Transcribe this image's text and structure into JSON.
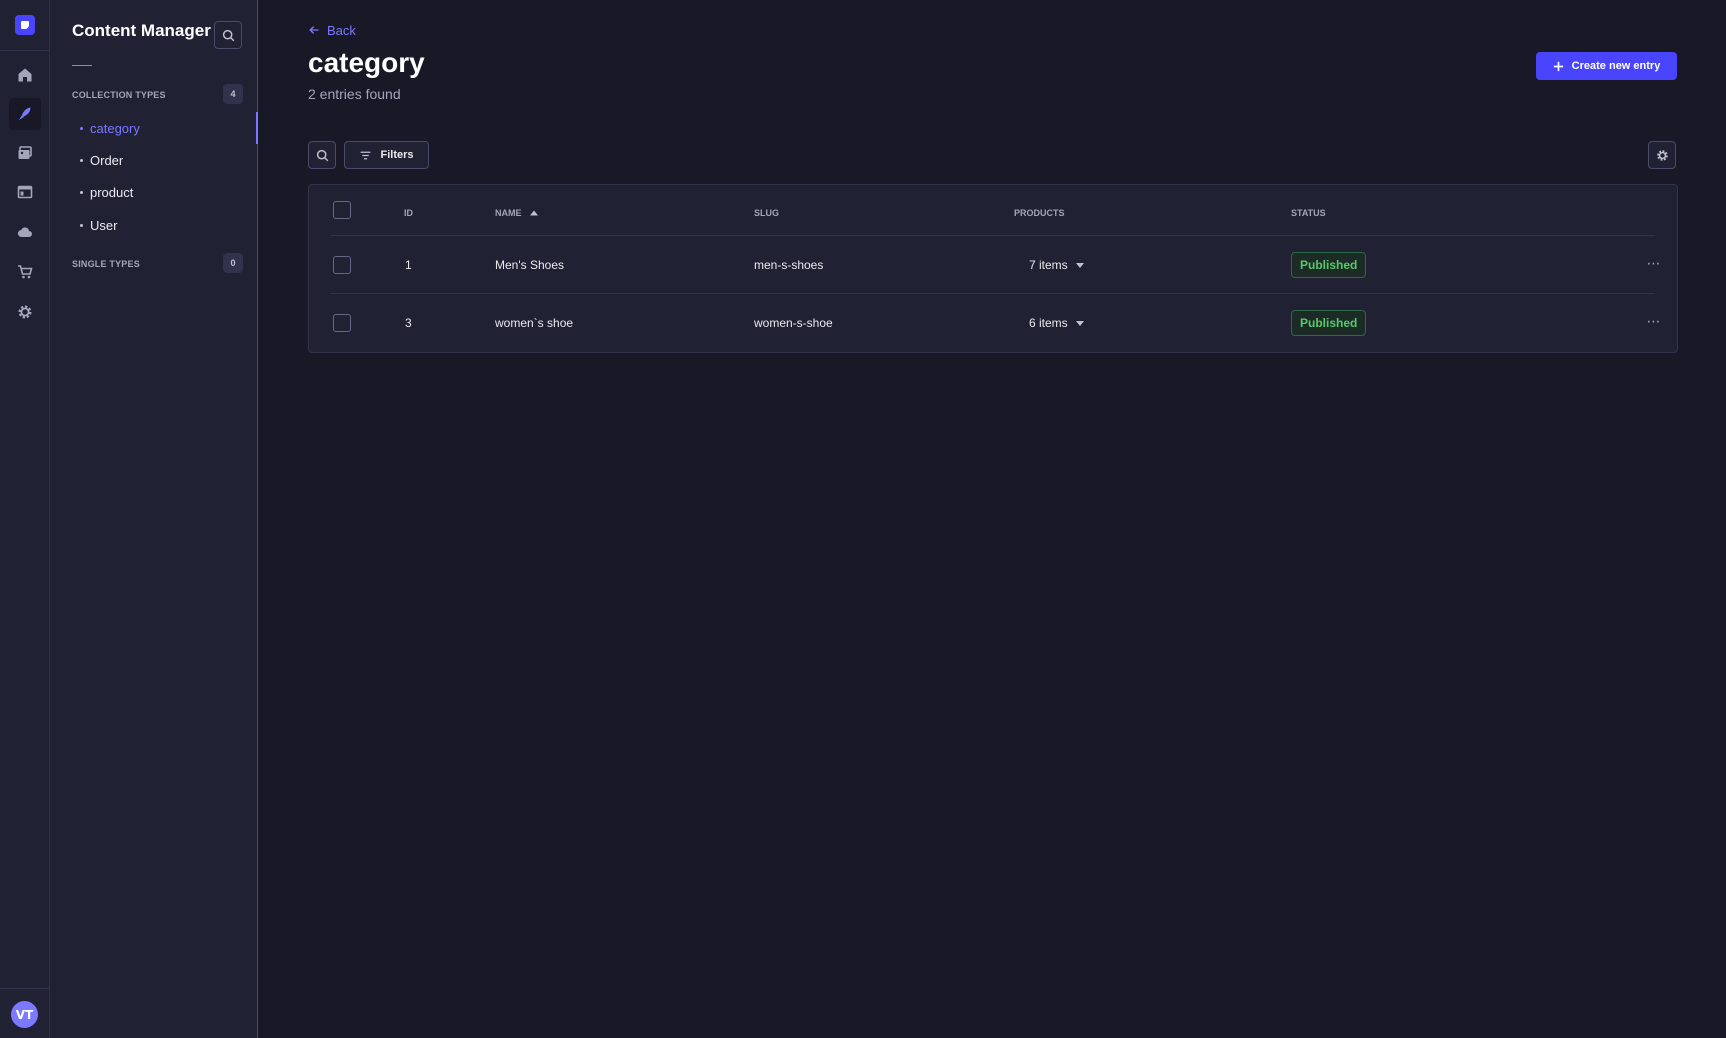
{
  "rail": {
    "icons": [
      "home-icon",
      "content-manager-icon",
      "media-library-icon",
      "content-type-builder-icon",
      "cloud-icon",
      "cart-icon",
      "settings-icon"
    ],
    "avatar_initials": "VT",
    "accent": "#4945ff"
  },
  "subnav": {
    "title": "Content Manager",
    "collection_types_label": "COLLECTION TYPES",
    "collection_types_count": "4",
    "items": [
      {
        "label": "category",
        "active": true
      },
      {
        "label": "Order",
        "active": false
      },
      {
        "label": "product",
        "active": false
      },
      {
        "label": "User",
        "active": false
      }
    ],
    "single_types_label": "SINGLE TYPES",
    "single_types_count": "0"
  },
  "header": {
    "back_label": "Back",
    "title": "category",
    "subtitle": "2 entries found",
    "create_label": "Create new entry"
  },
  "toolbar": {
    "filters_label": "Filters"
  },
  "table": {
    "columns": [
      "ID",
      "NAME",
      "SLUG",
      "PRODUCTS",
      "STATUS"
    ],
    "sort": {
      "column": "NAME",
      "direction": "asc"
    },
    "rows": [
      {
        "id": "1",
        "name": "Men's Shoes",
        "slug": "men-s-shoes",
        "products": "7 items",
        "status": "Published"
      },
      {
        "id": "3",
        "name": "women`s shoe",
        "slug": "women-s-shoe",
        "products": "6 items",
        "status": "Published"
      }
    ],
    "status_color": "#55cb68"
  }
}
